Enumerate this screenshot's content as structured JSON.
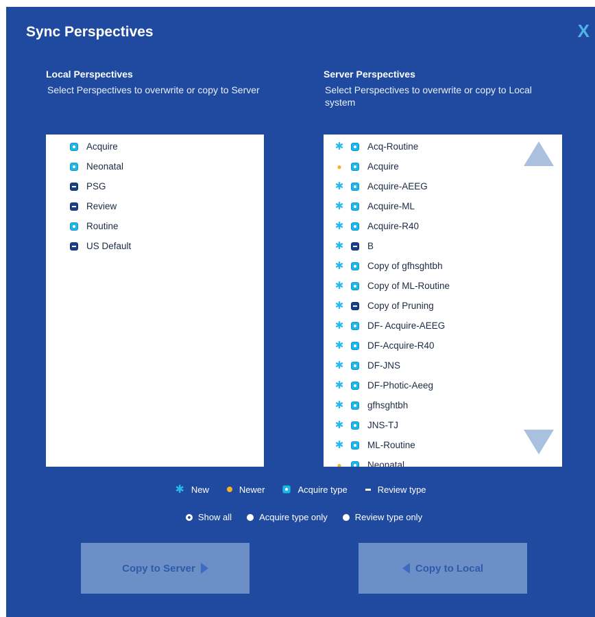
{
  "dialog": {
    "title": "Sync Perspectives",
    "close_label": "X"
  },
  "local": {
    "title": "Local Perspectives",
    "description": "Select Perspectives to overwrite or copy to Server",
    "items": [
      {
        "label": "Acquire",
        "type": "acquire"
      },
      {
        "label": "Neonatal",
        "type": "acquire"
      },
      {
        "label": "PSG",
        "type": "review"
      },
      {
        "label": "Review",
        "type": "review"
      },
      {
        "label": "Routine",
        "type": "acquire"
      },
      {
        "label": "US Default",
        "type": "review"
      }
    ]
  },
  "server": {
    "title": "Server Perspectives",
    "description": "Select Perspectives to overwrite or copy to Local system",
    "items": [
      {
        "label": "Acq-Routine",
        "status": "new",
        "type": "acquire"
      },
      {
        "label": "Acquire",
        "status": "newer",
        "type": "acquire"
      },
      {
        "label": "Acquire-AEEG",
        "status": "new",
        "type": "acquire"
      },
      {
        "label": "Acquire-ML",
        "status": "new",
        "type": "acquire"
      },
      {
        "label": "Acquire-R40",
        "status": "new",
        "type": "acquire"
      },
      {
        "label": "B",
        "status": "new",
        "type": "review"
      },
      {
        "label": "Copy of gfhsghtbh",
        "status": "new",
        "type": "acquire"
      },
      {
        "label": "Copy of ML-Routine",
        "status": "new",
        "type": "acquire"
      },
      {
        "label": "Copy of Pruning",
        "status": "new",
        "type": "review"
      },
      {
        "label": "DF- Acquire-AEEG",
        "status": "new",
        "type": "acquire"
      },
      {
        "label": "DF-Acquire-R40",
        "status": "new",
        "type": "acquire"
      },
      {
        "label": "DF-JNS",
        "status": "new",
        "type": "acquire"
      },
      {
        "label": "DF-Photic-Aeeg",
        "status": "new",
        "type": "acquire"
      },
      {
        "label": "gfhsghtbh",
        "status": "new",
        "type": "acquire"
      },
      {
        "label": "JNS-TJ",
        "status": "new",
        "type": "acquire"
      },
      {
        "label": "ML-Routine",
        "status": "new",
        "type": "acquire"
      },
      {
        "label": "Neonatal",
        "status": "newer",
        "type": "acquire"
      }
    ]
  },
  "legend": {
    "new": "New",
    "newer": "Newer",
    "acquire": "Acquire type",
    "review": "Review type"
  },
  "filters": {
    "selected": "Show all",
    "options": [
      "Show all",
      "Acquire type only",
      "Review type only"
    ]
  },
  "buttons": {
    "copy_to_server": "Copy to Server",
    "copy_to_local": "Copy to Local"
  },
  "colors": {
    "background": "#1f4aa0",
    "new": "#29b8ee",
    "newer": "#f5b31e",
    "button": "#6d8fc8"
  }
}
